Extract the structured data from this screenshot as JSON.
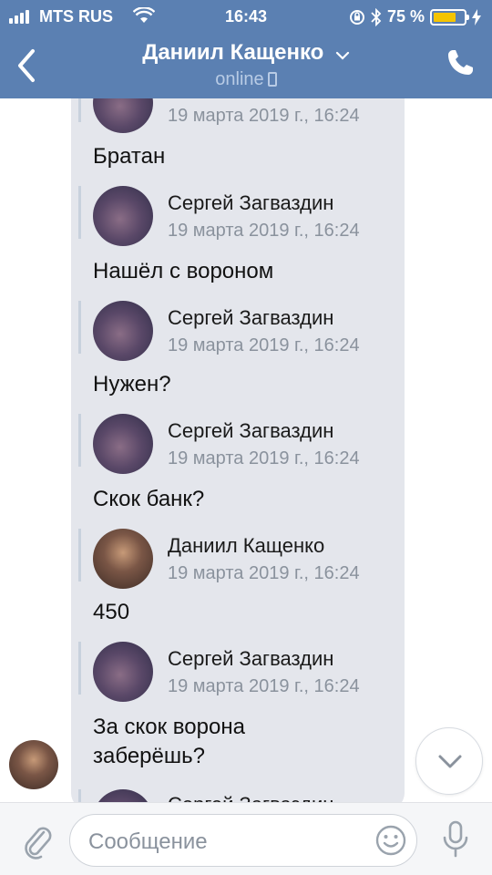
{
  "status_bar": {
    "carrier": "MTS RUS",
    "time": "16:43",
    "battery_percent": "75 %",
    "battery_level": 0.75
  },
  "header": {
    "title": "Даниил Кащенко",
    "subtitle": "online"
  },
  "messages": [
    {
      "author": "",
      "date": "19 марта 2019 г., 16:24",
      "text": "Братан"
    },
    {
      "author": "Сергей Загваздин",
      "date": "19 марта 2019 г., 16:24",
      "text": "Нашёл с вороном"
    },
    {
      "author": "Сергей Загваздин",
      "date": "19 марта 2019 г., 16:24",
      "text": "Нужен?"
    },
    {
      "author": "Сергей Загваздин",
      "date": "19 марта 2019 г., 16:24",
      "text": "Скок банк?"
    },
    {
      "author": "Даниил Кащенко",
      "date": "19 марта 2019 г., 16:24",
      "text": "450"
    },
    {
      "author": "Сергей Загваздин",
      "date": "19 марта 2019 г., 16:24",
      "text": "За скок ворона заберёшь?"
    },
    {
      "author": "Сергей Загваздин",
      "date": "",
      "text": ""
    }
  ],
  "input": {
    "placeholder": "Сообщение"
  },
  "colors": {
    "header_bg": "#5b80b2",
    "bubble_bg": "#e4e6ec",
    "battery": "#f5c400"
  },
  "icons": [
    "back-chevron-icon",
    "chevron-down-icon",
    "phone-icon",
    "attach-paperclip-icon",
    "emoji-icon",
    "microphone-icon",
    "wifi-icon",
    "bluetooth-icon",
    "rotation-lock-icon"
  ]
}
